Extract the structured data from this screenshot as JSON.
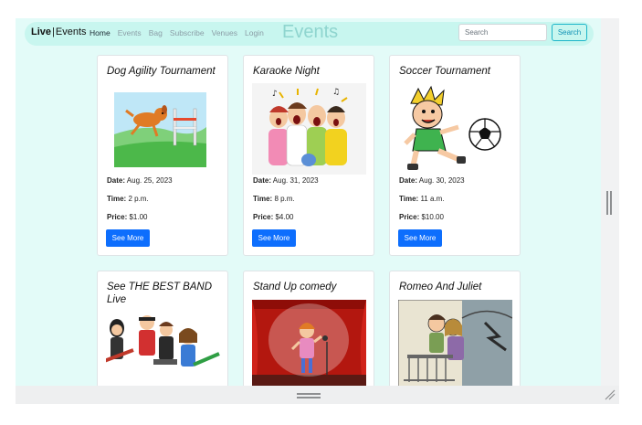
{
  "navbar": {
    "brand_left": "Live",
    "brand_separator": "|",
    "brand_right": "Events",
    "links": [
      "Home",
      "Events",
      "Bag",
      "Subscribe",
      "Venues",
      "Login"
    ],
    "active_link": "Home",
    "heading": "Events",
    "search_placeholder": "Search",
    "search_button": "Search"
  },
  "labels": {
    "date": "Date:",
    "time": "Time:",
    "price": "Price:",
    "see_more": "See More"
  },
  "events": [
    {
      "title": "Dog Agility Tournament",
      "date": "Aug. 25, 2023",
      "time": "2 p.m.",
      "price": "$1.00",
      "image": "dog-agility-image"
    },
    {
      "title": "Karaoke Night",
      "date": "Aug. 31, 2023",
      "time": "8 p.m.",
      "price": "$4.00",
      "image": "karaoke-image"
    },
    {
      "title": "Soccer Tournament",
      "date": "Aug. 30, 2023",
      "time": "11 a.m.",
      "price": "$10.00",
      "image": "soccer-image"
    },
    {
      "title": "See THE BEST BAND Live",
      "image": "band-image"
    },
    {
      "title": "Stand Up comedy",
      "image": "comedy-image"
    },
    {
      "title": "Romeo And Juliet",
      "image": "romeo-juliet-image"
    }
  ],
  "colors": {
    "page_background": "#e3fbf8",
    "navbar_background": "#c8f6ef",
    "heading": "#8fd5cf",
    "primary_button": "#0d6efd",
    "search_button_border": "#1bb5c9"
  }
}
